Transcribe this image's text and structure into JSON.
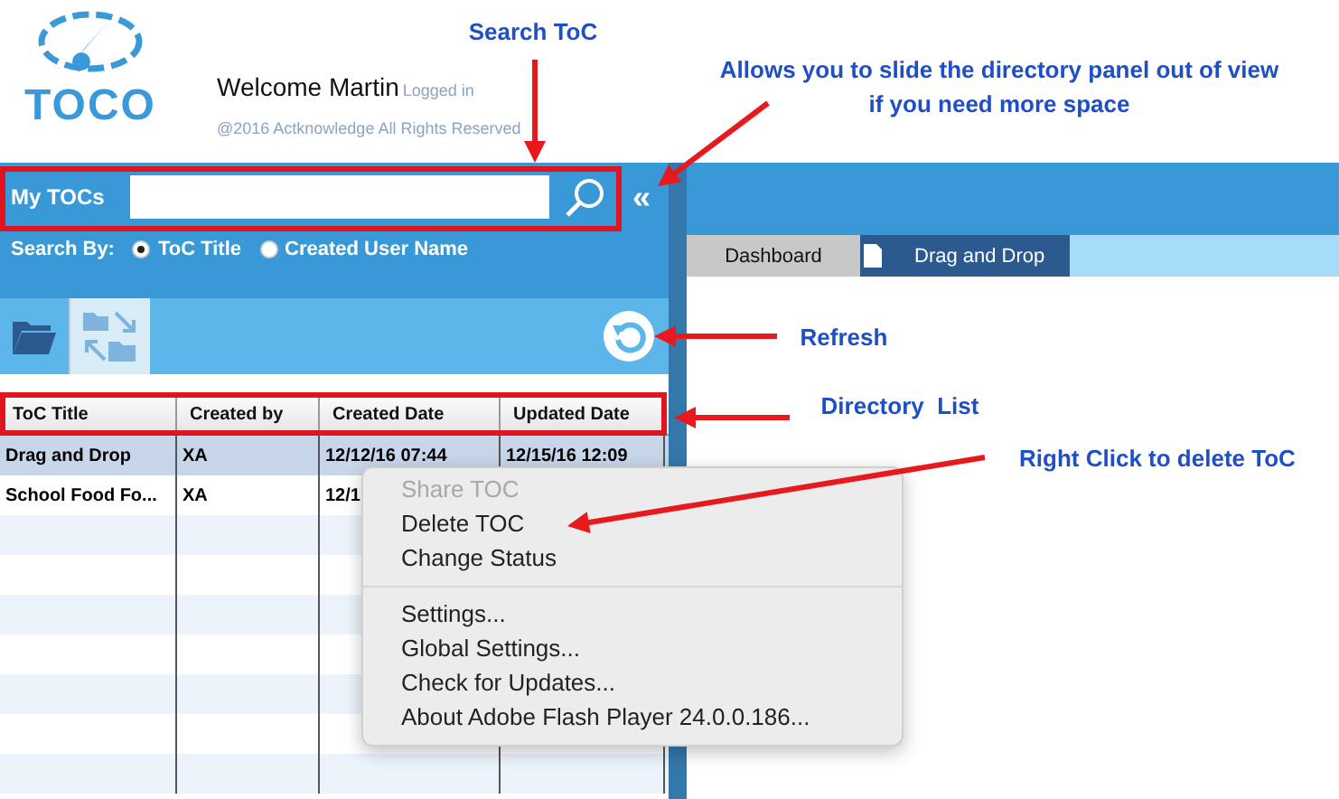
{
  "header": {
    "logo_text": "TOCO",
    "welcome": "Welcome Martin",
    "status": "Logged in",
    "copyright": "@2016 Actknowledge All Rights Reserved"
  },
  "sidebar": {
    "title": "My TOCs",
    "collapse": "«",
    "search_by_label": "Search By:",
    "search_by": [
      {
        "label": "ToC Title",
        "selected": true
      },
      {
        "label": "Created User Name",
        "selected": false
      }
    ],
    "table": {
      "columns": [
        "ToC Title",
        "Created by",
        "Created Date",
        "Updated Date"
      ],
      "rows": [
        {
          "selected": true,
          "cells": [
            "Drag and Drop",
            "XA",
            "12/12/16 07:44",
            "12/15/16 12:09"
          ]
        },
        {
          "selected": false,
          "cells": [
            "School Food Fo...",
            "XA",
            "12/1",
            ""
          ]
        }
      ]
    }
  },
  "tabs": [
    {
      "label": "Dashboard",
      "selected": false,
      "kind": "plain"
    },
    {
      "label": "Drag and Drop",
      "selected": true,
      "kind": "document"
    }
  ],
  "context_menu": [
    {
      "label": "Share TOC",
      "disabled": true,
      "separator_before": false
    },
    {
      "label": "Delete TOC",
      "disabled": false,
      "separator_before": false
    },
    {
      "label": "Change Status",
      "disabled": false,
      "separator_before": false
    },
    {
      "label": "Settings...",
      "disabled": false,
      "separator_before": true
    },
    {
      "label": "Global Settings...",
      "disabled": false,
      "separator_before": false
    },
    {
      "label": "Check for Updates...",
      "disabled": false,
      "separator_before": false
    },
    {
      "label": "About Adobe Flash Player 24.0.0.186...",
      "disabled": false,
      "separator_before": false
    }
  ],
  "annotations": [
    {
      "text": "Search ToC"
    },
    {
      "text": "Allows you to slide the directory panel out of view\nif you need more space"
    },
    {
      "text": "Refresh"
    },
    {
      "text": "Directory  List"
    },
    {
      "text": "Right Click to delete ToC"
    }
  ]
}
